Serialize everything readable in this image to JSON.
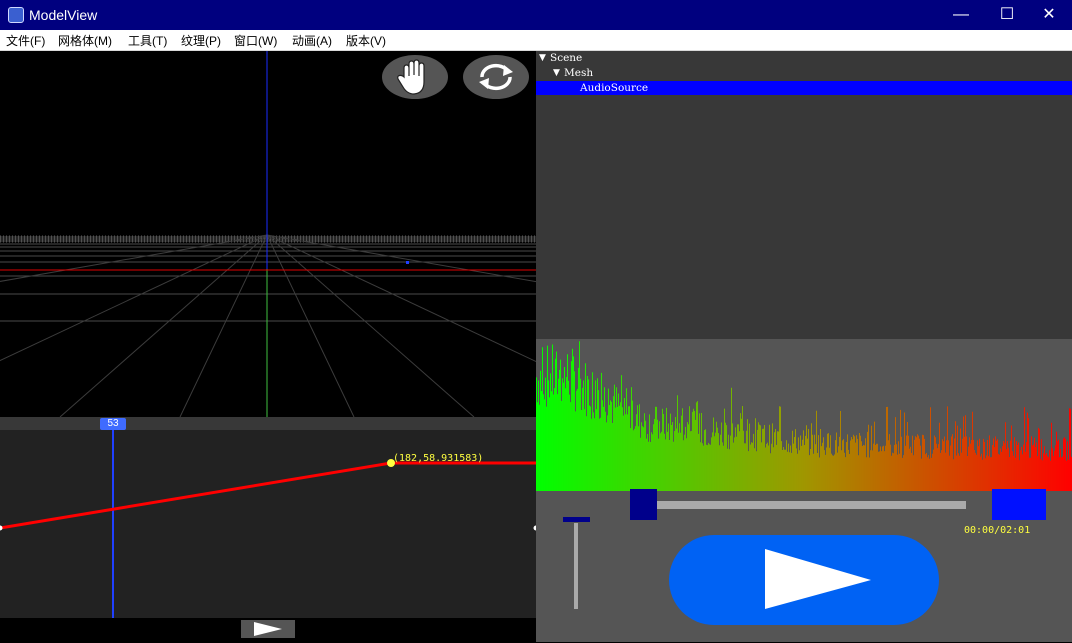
{
  "window": {
    "title": "ModelView",
    "minimize_glyph": "—",
    "maximize_glyph": "☐",
    "close_glyph": "✕"
  },
  "menu": [
    "文件(F)",
    "网格体(M)",
    "工具(T)",
    "纹理(P)",
    "窗口(W)",
    "动画(A)",
    "版本(V)"
  ],
  "viewport": {
    "pan_icon": "hand-icon",
    "orbit_icon": "rotate-icon"
  },
  "curve_editor": {
    "current_frame": "53",
    "keyframe_label": "(182,58.931583)"
  },
  "scene_tree": [
    {
      "label": "Scene",
      "expanded": true,
      "selected": false
    },
    {
      "label": "Mesh",
      "expanded": true,
      "selected": false
    },
    {
      "label": "AudioSource",
      "expanded": false,
      "selected": true
    }
  ],
  "audio": {
    "time_display": "00:00/02:01",
    "progress": 0.0,
    "spectrum_colors": {
      "low": "#00ff00",
      "high": "#ff0000"
    }
  },
  "colors": {
    "titlebar": "#00007f",
    "selection": "#0000ff",
    "play_button": "#0062f4",
    "curve": "#ff0000",
    "playhead": "#2040ff"
  }
}
